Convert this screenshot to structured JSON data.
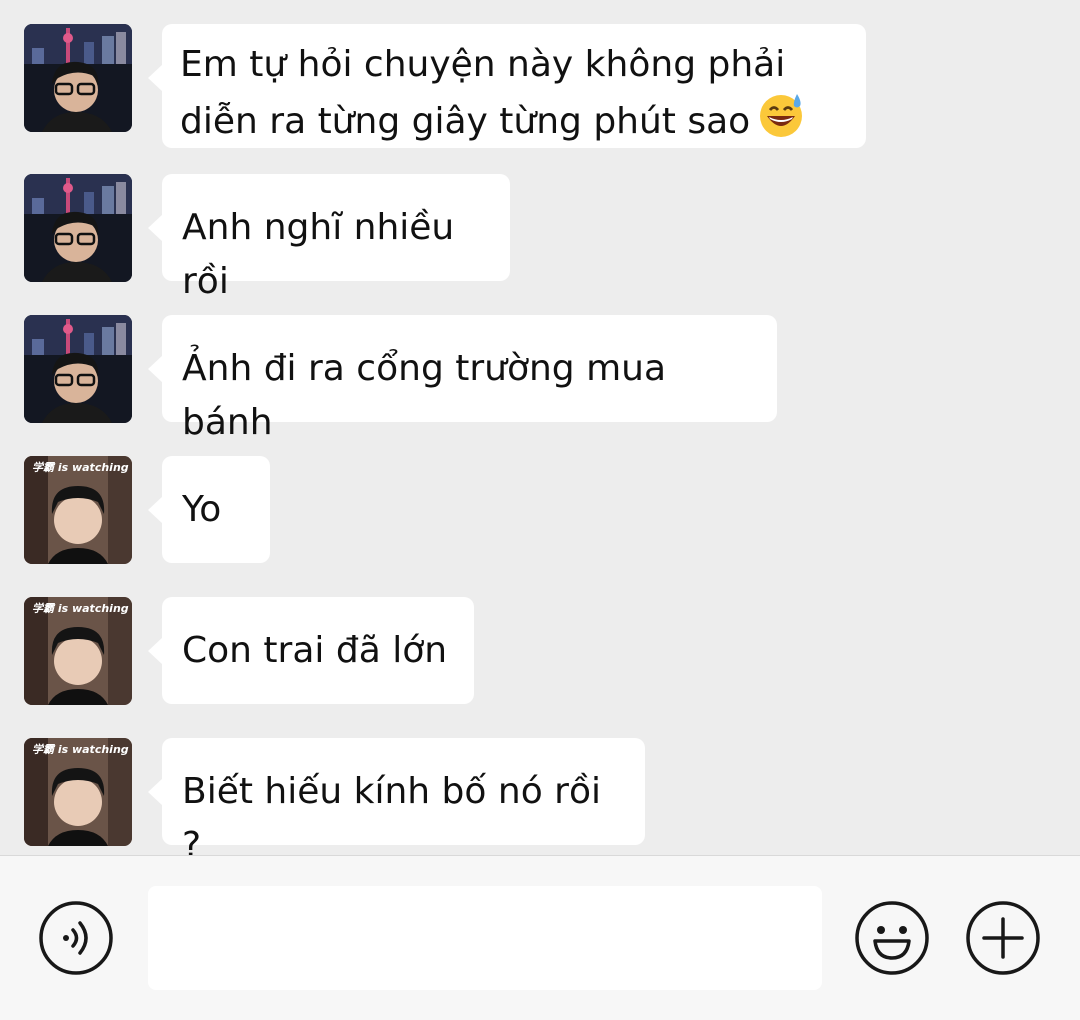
{
  "messages": [
    {
      "sender": "a",
      "text": "Em tự hỏi chuyện này không phải diễn ra từng giây từng phút sao",
      "emoji": "sweat-smile-emoji"
    },
    {
      "sender": "a",
      "text": "Anh nghĩ nhiều rồi"
    },
    {
      "sender": "a",
      "text": "Ảnh đi ra cổng trường mua bánh"
    },
    {
      "sender": "b",
      "text": "Yo"
    },
    {
      "sender": "b",
      "text": "Con trai đã lớn"
    },
    {
      "sender": "b",
      "text": "Biết hiếu kính bố nó rồi ?"
    }
  ],
  "avatar_b_caption": "学霸 is watching u",
  "input": {
    "value": "",
    "placeholder": ""
  },
  "icons": {
    "voice": "voice-icon",
    "emoji": "emoji-icon",
    "plus": "plus-icon"
  },
  "colors": {
    "background": "#ededed",
    "bubble": "#ffffff",
    "input_bar": "#f7f7f7",
    "icon_stroke": "#181818"
  }
}
